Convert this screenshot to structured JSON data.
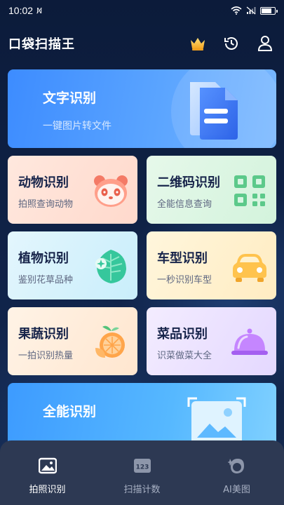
{
  "status_bar": {
    "time": "10:02",
    "no_sim_glyph": "N̸",
    "battery_level": 0.8
  },
  "header": {
    "title": "口袋扫描王",
    "icons": [
      "crown-icon",
      "history-icon",
      "user-icon"
    ]
  },
  "hero": {
    "title": "文字识别",
    "subtitle": "一键图片转文件",
    "icon": "document-icon"
  },
  "cards": [
    {
      "title": "动物识别",
      "subtitle": "拍照查询动物",
      "icon": "panda-icon"
    },
    {
      "title": "二维码识别",
      "subtitle": "全能信息查询",
      "icon": "qrcode-icon"
    },
    {
      "title": "植物识别",
      "subtitle": "鉴别花草品种",
      "icon": "leaf-icon"
    },
    {
      "title": "车型识别",
      "subtitle": "一秒识别车型",
      "icon": "car-icon"
    },
    {
      "title": "果蔬识别",
      "subtitle": "一拍识别热量",
      "icon": "fruit-icon"
    },
    {
      "title": "菜品识别",
      "subtitle": "识菜做菜大全",
      "icon": "dish-icon"
    }
  ],
  "hero2": {
    "title": "全能识别",
    "icon": "image-scan-icon"
  },
  "bottom_nav": [
    {
      "label": "拍照识别",
      "icon": "photo-icon",
      "active": true
    },
    {
      "label": "扫描计数",
      "icon": "count-123-icon",
      "active": false,
      "icon_text": "123"
    },
    {
      "label": "AI美图",
      "icon": "ai-portrait-icon",
      "active": false
    }
  ],
  "colors": {
    "accent": "#3d8cff",
    "nav_bg": "#2d3953",
    "page_bg": "#0d1d3e"
  }
}
